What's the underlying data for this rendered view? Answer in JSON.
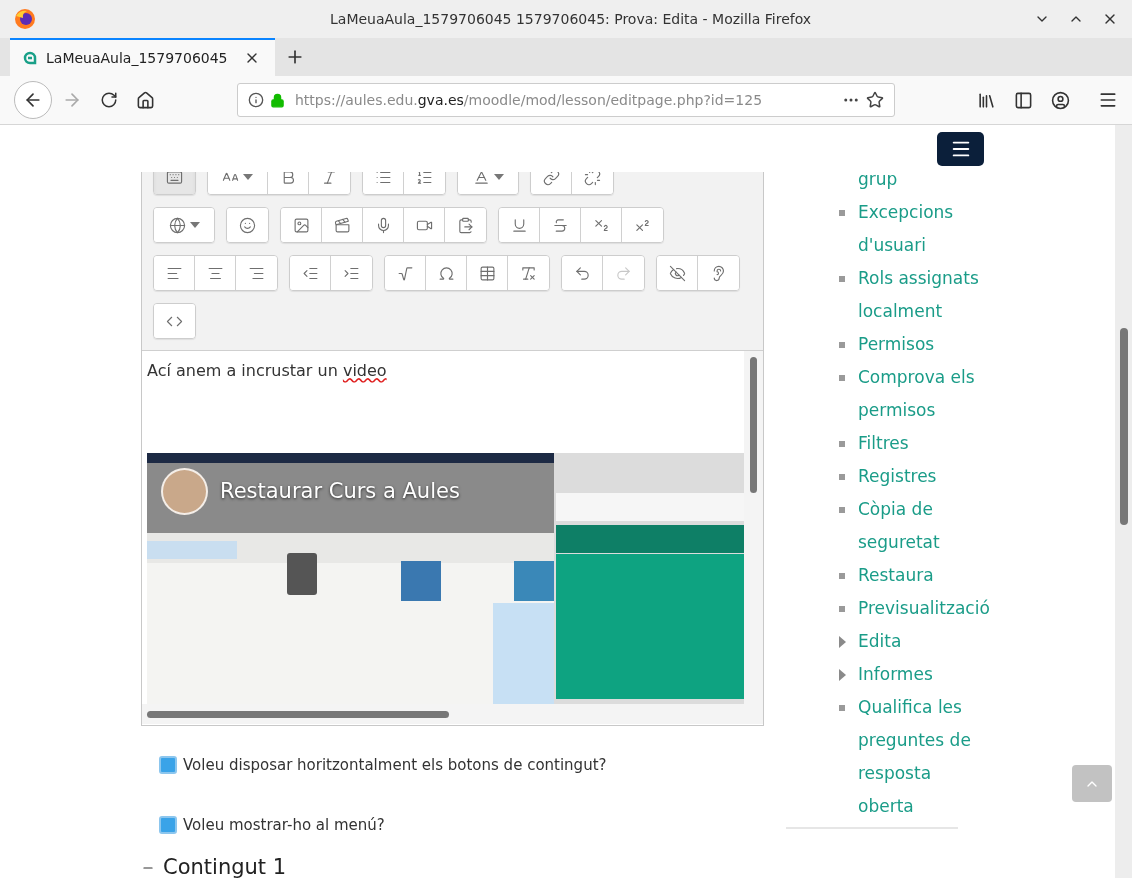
{
  "window": {
    "title": "LaMeuaAula_1579706045 1579706045: Prova: Edita - Mozilla Firefox"
  },
  "tabs": [
    {
      "label": "LaMeuaAula_1579706045",
      "selected": true
    }
  ],
  "address_bar": {
    "scheme_host": "https://aules.edu.",
    "domain": "gva.es",
    "path": "/moodle/mod/lesson/editpage.php?id=125"
  },
  "editor": {
    "content": [
      {
        "text": "Ací anem a incrustar un",
        "misspelled": false
      },
      {
        "text": "video",
        "misspelled": true
      }
    ],
    "video": {
      "kind": "picture",
      "title": "Restaurar Curs a Aules"
    }
  },
  "checkboxes": [
    {
      "label": "Voleu disposar horitzontalment els botons de contingut?",
      "checked": true
    },
    {
      "label": "Voleu mostrar-ho al menú?",
      "checked": true
    }
  ],
  "section": {
    "title": "Contingut 1",
    "expanded": true
  },
  "sidebar": {
    "items": [
      {
        "label": "grup",
        "kind": "continuation"
      },
      {
        "label": "Excepcions d'usuari",
        "kind": "leaf"
      },
      {
        "label": "Rols assignats localment",
        "kind": "leaf"
      },
      {
        "label": "Permisos",
        "kind": "leaf"
      },
      {
        "label": "Comprova els permisos",
        "kind": "leaf"
      },
      {
        "label": "Filtres",
        "kind": "leaf"
      },
      {
        "label": "Registres",
        "kind": "leaf"
      },
      {
        "label": "Còpia de seguretat",
        "kind": "leaf"
      },
      {
        "label": "Restaura",
        "kind": "leaf"
      },
      {
        "label": "Previsualització",
        "kind": "leaf"
      },
      {
        "label": "Edita",
        "kind": "branch"
      },
      {
        "label": "Informes",
        "kind": "branch"
      },
      {
        "label": "Qualifica les preguntes de resposta oberta",
        "kind": "leaf"
      }
    ]
  }
}
